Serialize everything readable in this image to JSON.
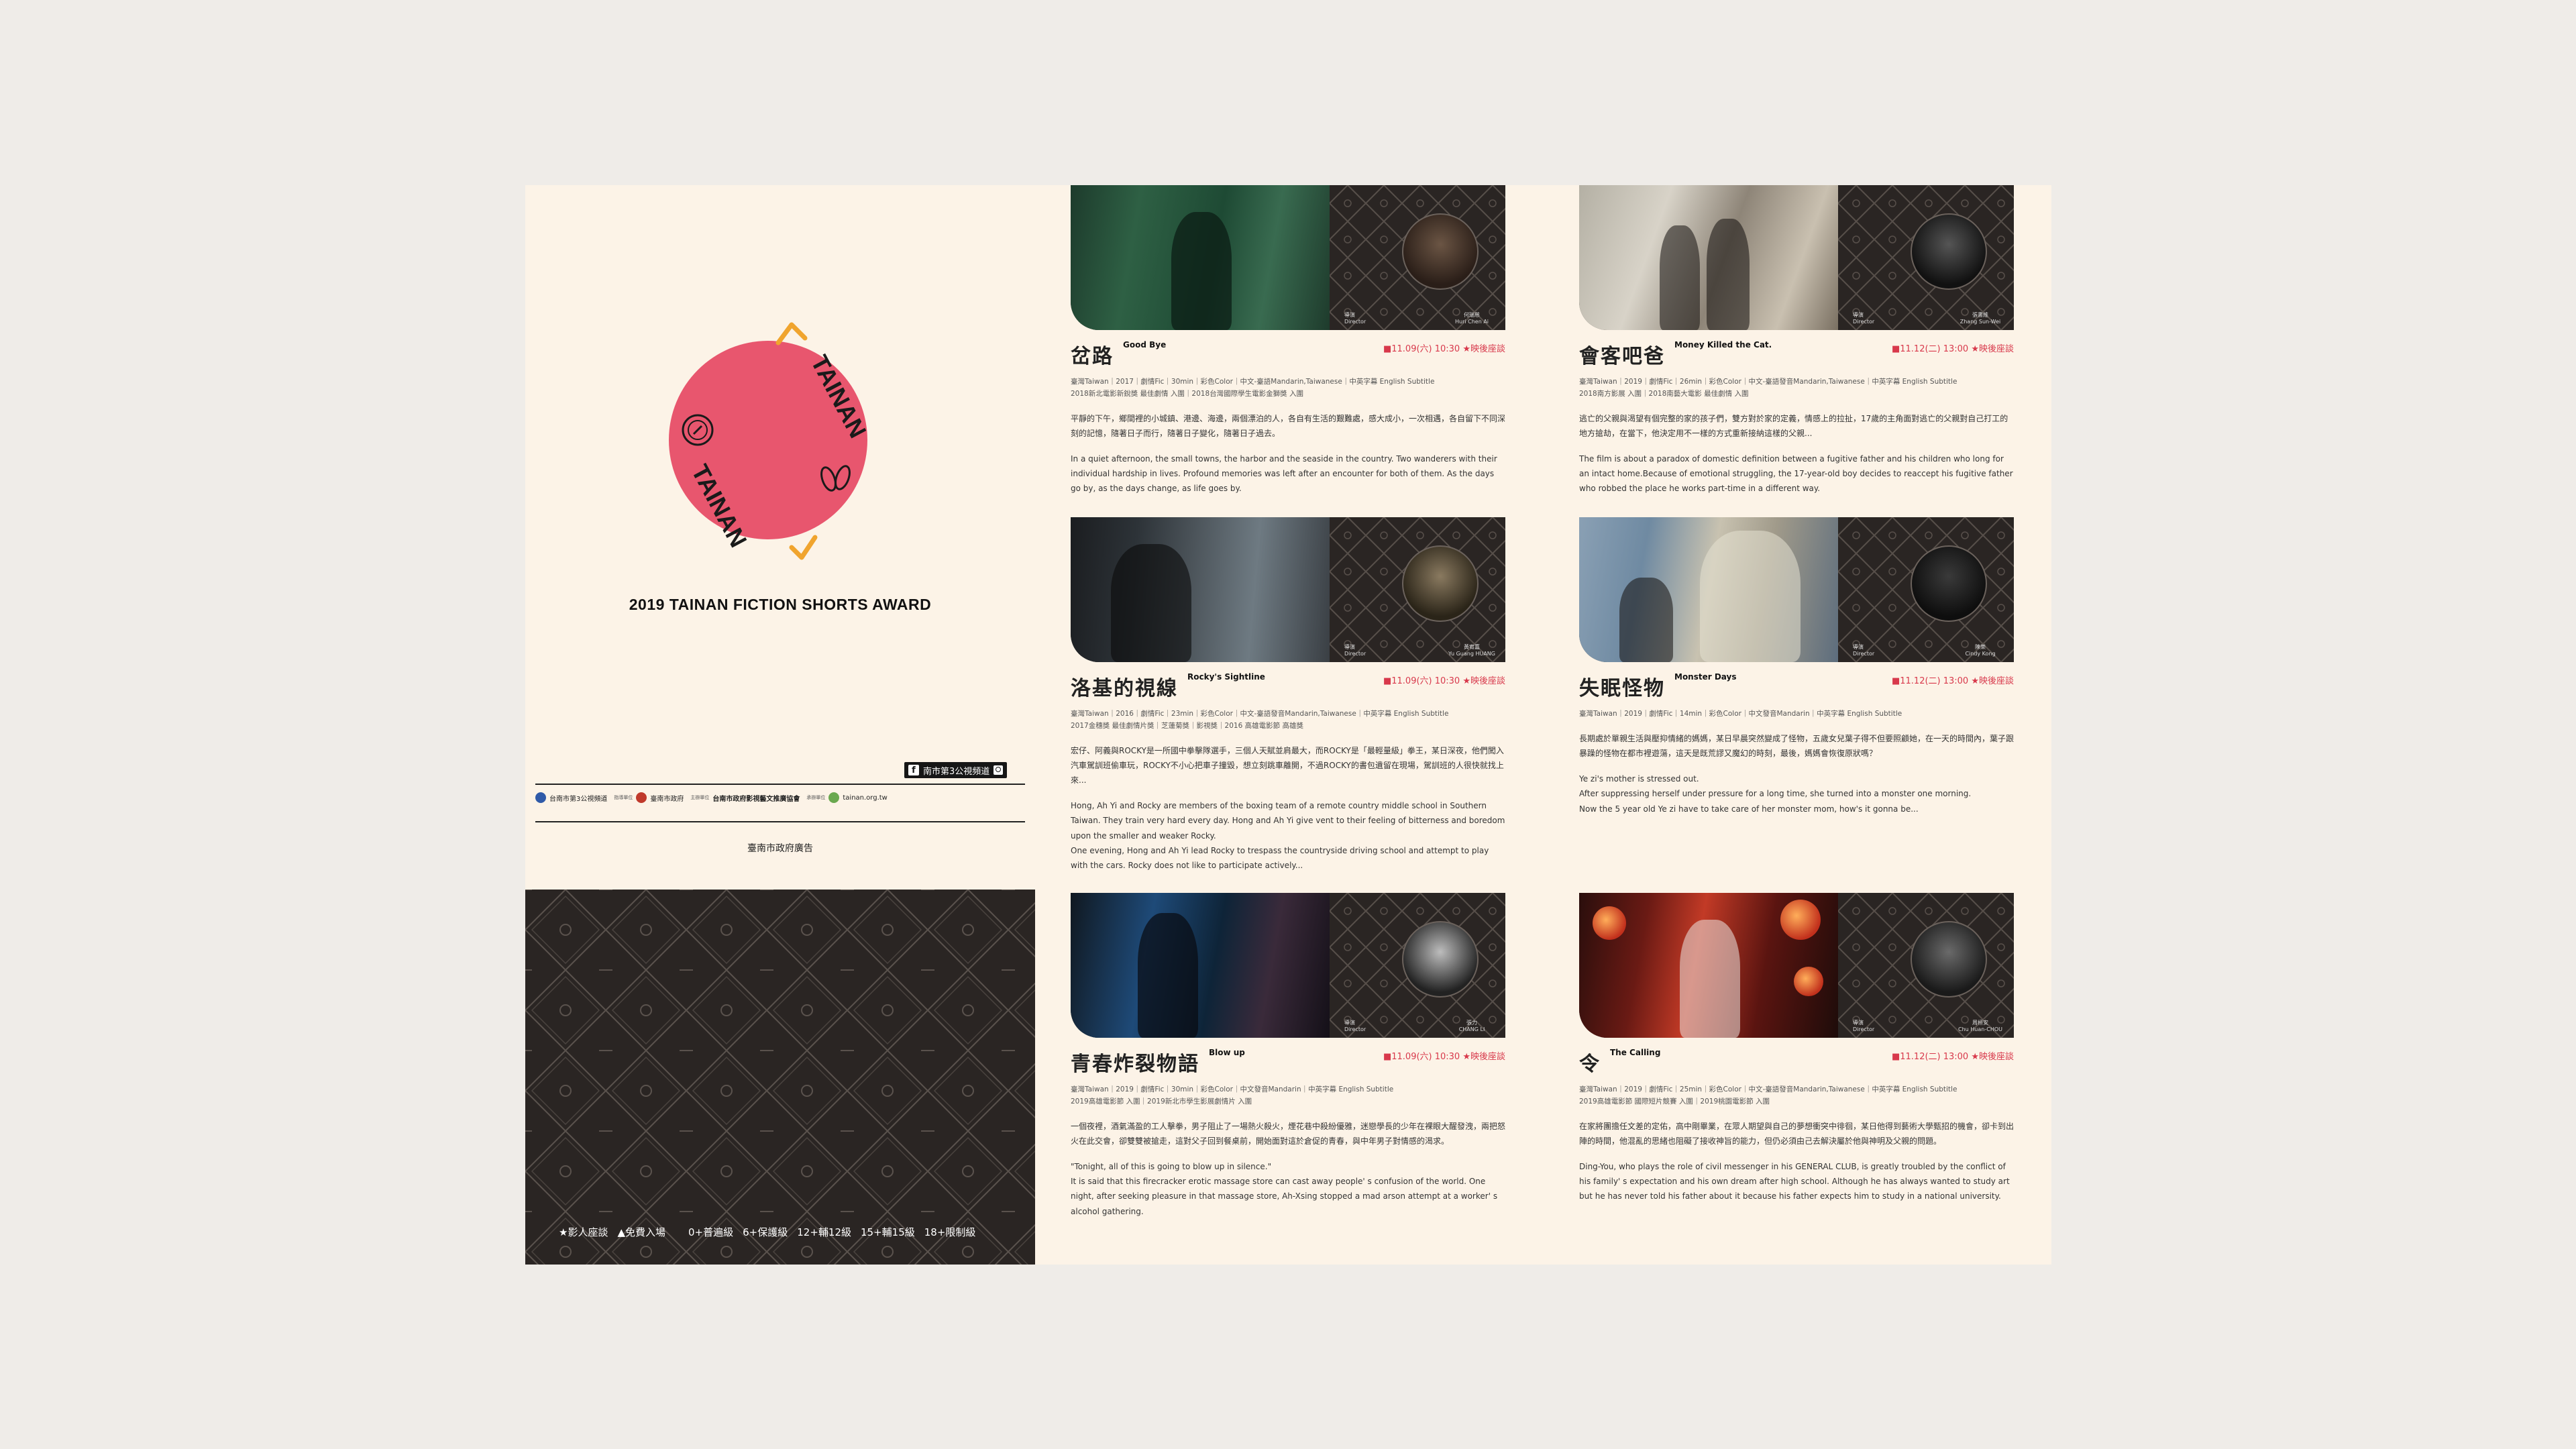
{
  "cover": {
    "logo_text_top": "TAINAN",
    "logo_text_bottom": "TAINAN",
    "award_title": "2019 TAINAN FICTION SHORTS AWARD",
    "fb_tag": "南市第3公視頻道",
    "sponsors": [
      {
        "name": "台南市第3公視頻道",
        "role": ""
      },
      {
        "name": "臺南市政府",
        "role": "指導單位"
      },
      {
        "name": "台南市政府影視藝文推廣協會",
        "role": "主辦單位"
      },
      {
        "name": "tainan.org.tw",
        "role": "承辦單位"
      }
    ],
    "gov_ad": "臺南市政府廣告",
    "legend_left": [
      "★影人座談",
      "▲免費入場"
    ],
    "legend_right": [
      "0+普遍級",
      "6+保護級",
      "12+輔12級",
      "15+輔15級",
      "18+限制級"
    ]
  },
  "films": [
    {
      "title_zh": "岔路",
      "title_en": "Good Bye",
      "screening": "■11.09(六) 10:30 ★映後座談",
      "director_label": "導演\nDirector",
      "director_name": "何瑞慈\nHuri Chen Ai",
      "meta": "臺灣Taiwan｜2017｜劇情Fic｜30min｜彩色Color｜中文-臺語Mandarin,Taiwanese｜中英字幕 English Subtitle\n2018新北電影新銳獎 最佳劇情 入圍｜2018台灣國際學生電影金獅獎 入圍",
      "syn_zh": "平靜的下午，鄉間裡的小城鎮、港邊、海邊，兩個漂泊的人，各自有生活的艱難處，感大成小，一次相遇，各自留下不同深刻的記憶，隨著日子而行，隨著日子變化，隨著日子過去。",
      "syn_en": "In a quiet afternoon, the small towns, the harbor and the seaside in the country. Two wanderers with their individual hardship in lives. Profound memories was left after an encounter for both of them. As the days go by, as the days change, as life goes by."
    },
    {
      "title_zh": "會客吧爸",
      "title_en": "Money Killed the Cat.",
      "screening": "■11.12(二) 13:00 ★映後座談",
      "director_label": "導演\nDirector",
      "director_name": "張書維\nZhang Sun-Wei",
      "meta": "臺灣Taiwan｜2019｜劇情Fic｜26min｜彩色Color｜中文-臺語發音Mandarin,Taiwanese｜中英字幕 English Subtitle\n2018南方影展 入圍｜2018南藝大電影 最佳劇情 入圍",
      "syn_zh": "逃亡的父親與渴望有個完整的家的孩子們，雙方對於家的定義，情感上的拉扯，17歲的主角面對逃亡的父親對自己打工的地方搶劫，在當下，他決定用不一樣的方式重新接納這樣的父親...",
      "syn_en": "The film is about a paradox of domestic definition between a fugitive father and his children who long for an intact home.Because of emotional struggling, the 17-year-old boy decides to reaccept his fugitive father who robbed the place he works part-time in a different way."
    },
    {
      "title_zh": "洛基的視線",
      "title_en": "Rocky's Sightline",
      "screening": "■11.09(六) 10:30 ★映後座談",
      "director_label": "導演\nDirector",
      "director_name": "黃宥嘉\nYu Guang HUANG",
      "meta": "臺灣Taiwan｜2016｜劇情Fic｜23min｜彩色Color｜中文-臺語發音Mandarin,Taiwanese｜中英字幕 English Subtitle\n2017金穗獎 最佳劇情片獎｜芝蓮菊獎｜影視獎｜2016 高雄電影節 高雄獎",
      "syn_zh": "宏仔、阿義與ROCKY是一所國中拳擊隊選手，三個人天賦並肩最大，而ROCKY是「最輕量級」拳王，某日深夜，他們闖入汽車駕訓班偷車玩，ROCKY不小心把車子撞毀，想立刻跳車離開，不過ROCKY的書包遺留在現場，駕訓班的人很快就找上來...",
      "syn_en": "Hong, Ah Yi and Rocky are members of the boxing team of a remote country middle school in Southern Taiwan. They train very hard every day. Hong and Ah Yi give vent to their feeling of bitterness and boredom upon the smaller and weaker Rocky.\nOne evening, Hong and Ah Yi lead Rocky to trespass the countryside driving school and attempt to play with the cars. Rocky does not like to participate actively..."
    },
    {
      "title_zh": "失眠怪物",
      "title_en": "Monster Days",
      "screening": "■11.12(二) 13:00 ★映後座談",
      "director_label": "導演\nDirector",
      "director_name": "陳樂\nCindy Kong",
      "meta": "臺灣Taiwan｜2019｜劇情Fic｜14min｜彩色Color｜中文發音Mandarin｜中英字幕 English Subtitle",
      "syn_zh": "長期處於單親生活與壓抑情緒的媽媽，某日早晨突然變成了怪物，五歲女兒葉子得不但要照顧她，在一天的時間內，葉子跟暴躁的怪物在都市裡遊蕩，這天是既荒謬又魔幻的時刻，最後，媽媽會恢復原狀嗎？",
      "syn_en": "Ye zi's mother is stressed out.\nAfter suppressing herself under pressure for a long time, she turned into a monster one morning.\nNow the 5 year old Ye zi have to take care of her monster mom, how's it gonna be..."
    },
    {
      "title_zh": "青春炸裂物語",
      "title_en": "Blow up",
      "screening": "■11.09(六) 10:30 ★映後座談",
      "director_label": "導演\nDirector",
      "director_name": "張力\nCHANG LI",
      "meta": "臺灣Taiwan｜2019｜劇情Fic｜30min｜彩色Color｜中文發音Mandarin｜中英字幕 English Subtitle\n2019高雄電影節 入圍｜2019新北市學生影展劇情片 入圍",
      "syn_zh": "一個夜裡，酒氣滿盈的工人擊拳，男子阻止了一場熱火殺火，煙花巷中殺紛優雅，迷戀學長的少年在裸眼大醒發洩，兩把怒火在此交會，卻雙雙被搶走，這對父子回到餐桌前，開始面對這於倉促的青春，與中年男子對情感的渴求。",
      "syn_en": "\"Tonight, all of this is going to blow up in silence.\"\nIt is said that this firecracker erotic massage store can cast away people' s confusion of the world. One night, after seeking pleasure in that massage store, Ah-Xsing stopped a mad arson attempt at a worker' s alcohol gathering."
    },
    {
      "title_zh": "令",
      "title_en": "The Calling",
      "screening": "■11.12(二) 13:00 ★映後座談",
      "director_label": "導演\nDirector",
      "director_name": "周桓安\nChu Huan-CHOU",
      "meta": "臺灣Taiwan｜2019｜劇情Fic｜25min｜彩色Color｜中文-臺語發音Mandarin,Taiwanese｜中英字幕 English Subtitle\n2019高雄電影節 國際短片競賽 入圍｜2019桃園電影節 入圍",
      "syn_zh": "在家將團擔任文差的定佑，高中剛畢業，在眾人期望與自己的夢想衝突中徘徊，某日他得到藝術大學甄招的機會，卻卡到出陣的時間，他混亂的思緒也阻礙了接收神旨的能力，但仍必須由己去解決屬於他與神明及父親的問題。",
      "syn_en": "Ding-You, who plays the role of civil messenger in his GENERAL CLUB, is greatly troubled by the conflict of his family' s expectation and his own dream after high school. Although he has always wanted to study art but he has never told his father about it because his father expects him to study in a national university."
    }
  ],
  "colors": {
    "accent_red": "#e8566e",
    "accent_gold": "#f0a42e",
    "screening_red": "#d8384b",
    "dark_panel": "#2a2523",
    "paper": "#fcf3e7"
  }
}
